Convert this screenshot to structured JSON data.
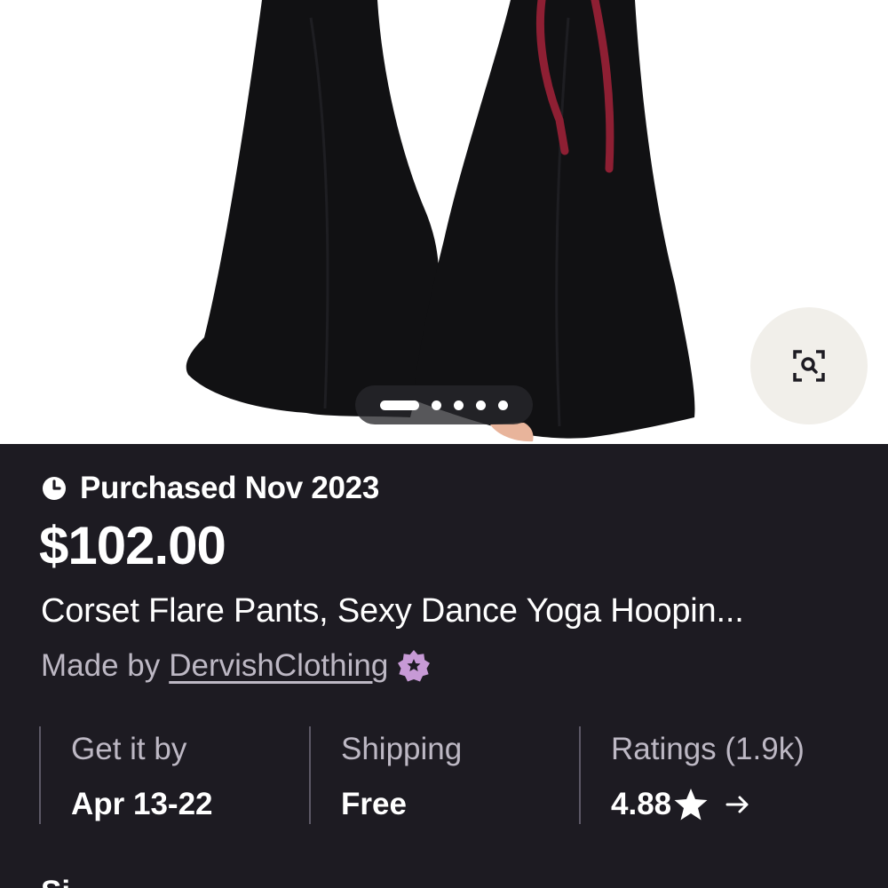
{
  "gallery": {
    "slide_count": 5,
    "active_slide": 1,
    "zoom_icon": "zoom-search-icon"
  },
  "listing": {
    "purchased_text": "Purchased Nov 2023",
    "purchased_icon": "clock-icon",
    "price": "$102.00",
    "title": "Corset Flare Pants, Sexy Dance Yoga Hoopin...",
    "made_by_prefix": "Made by",
    "shop_name": "DervishClothing",
    "star_seller_icon": "star-seller-badge-icon"
  },
  "stats": {
    "delivery": {
      "label": "Get it by",
      "value": "Apr 13-22"
    },
    "shipping": {
      "label": "Shipping",
      "value": "Free"
    },
    "ratings": {
      "label": "Ratings (1.9k)",
      "value": "4.88",
      "icon": "star-icon",
      "arrow_icon": "arrow-right-icon"
    }
  },
  "next_section": {
    "label": "Si"
  },
  "colors": {
    "background": "#1d1b22",
    "muted_text": "#bdb8c4",
    "divider": "#5c5866",
    "badge": "#c79ad6",
    "zoom_button": "#f1efea"
  }
}
